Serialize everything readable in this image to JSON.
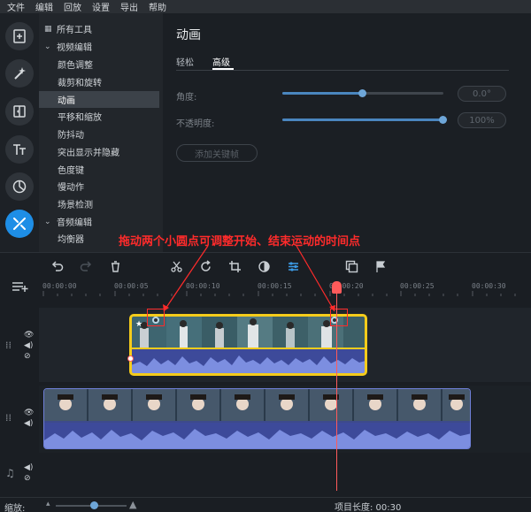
{
  "menu": [
    "文件",
    "编辑",
    "回放",
    "设置",
    "导出",
    "帮助"
  ],
  "tools": [
    {
      "label": "所有工具",
      "kind": "head",
      "icon": "grid-icon"
    },
    {
      "label": "视频编辑",
      "kind": "head",
      "icon": "chevron-down-icon"
    },
    {
      "label": "颜色调整",
      "kind": "sub"
    },
    {
      "label": "裁剪和旋转",
      "kind": "sub"
    },
    {
      "label": "动画",
      "kind": "sub",
      "selected": true
    },
    {
      "label": "平移和缩放",
      "kind": "sub"
    },
    {
      "label": "防抖动",
      "kind": "sub"
    },
    {
      "label": "突出显示并隐藏",
      "kind": "sub"
    },
    {
      "label": "色度键",
      "kind": "sub"
    },
    {
      "label": "慢动作",
      "kind": "sub"
    },
    {
      "label": "场景检测",
      "kind": "sub"
    },
    {
      "label": "音频编辑",
      "kind": "head",
      "icon": "chevron-down-icon"
    },
    {
      "label": "均衡器",
      "kind": "sub"
    }
  ],
  "panel": {
    "title": "动画",
    "tabs": [
      "轻松",
      "高级"
    ],
    "active_tab": "高级",
    "angle": {
      "label": "角度:",
      "value": "0.0°",
      "level": 0.5
    },
    "opacity": {
      "label": "不透明度:",
      "value": "100%",
      "level": 1.0
    },
    "add_keyframe": "添加关键帧"
  },
  "annotation": "拖动两个小圆点可调整开始、结束运动的时间点",
  "ruler": [
    "00:00:00",
    "00:00:05",
    "00:00:10",
    "00:00:15",
    "00:00:20",
    "00:00:25",
    "00:00:30"
  ],
  "status": {
    "zoom_label": "缩放:",
    "project_length": "项目长度: 00:30"
  },
  "colors": {
    "accent": "#1e8ee6",
    "clip_border": "#f5cc1b",
    "playhead": "#ff5b5b",
    "annotation": "#ff2b2b",
    "audio": "#6f80d8"
  }
}
